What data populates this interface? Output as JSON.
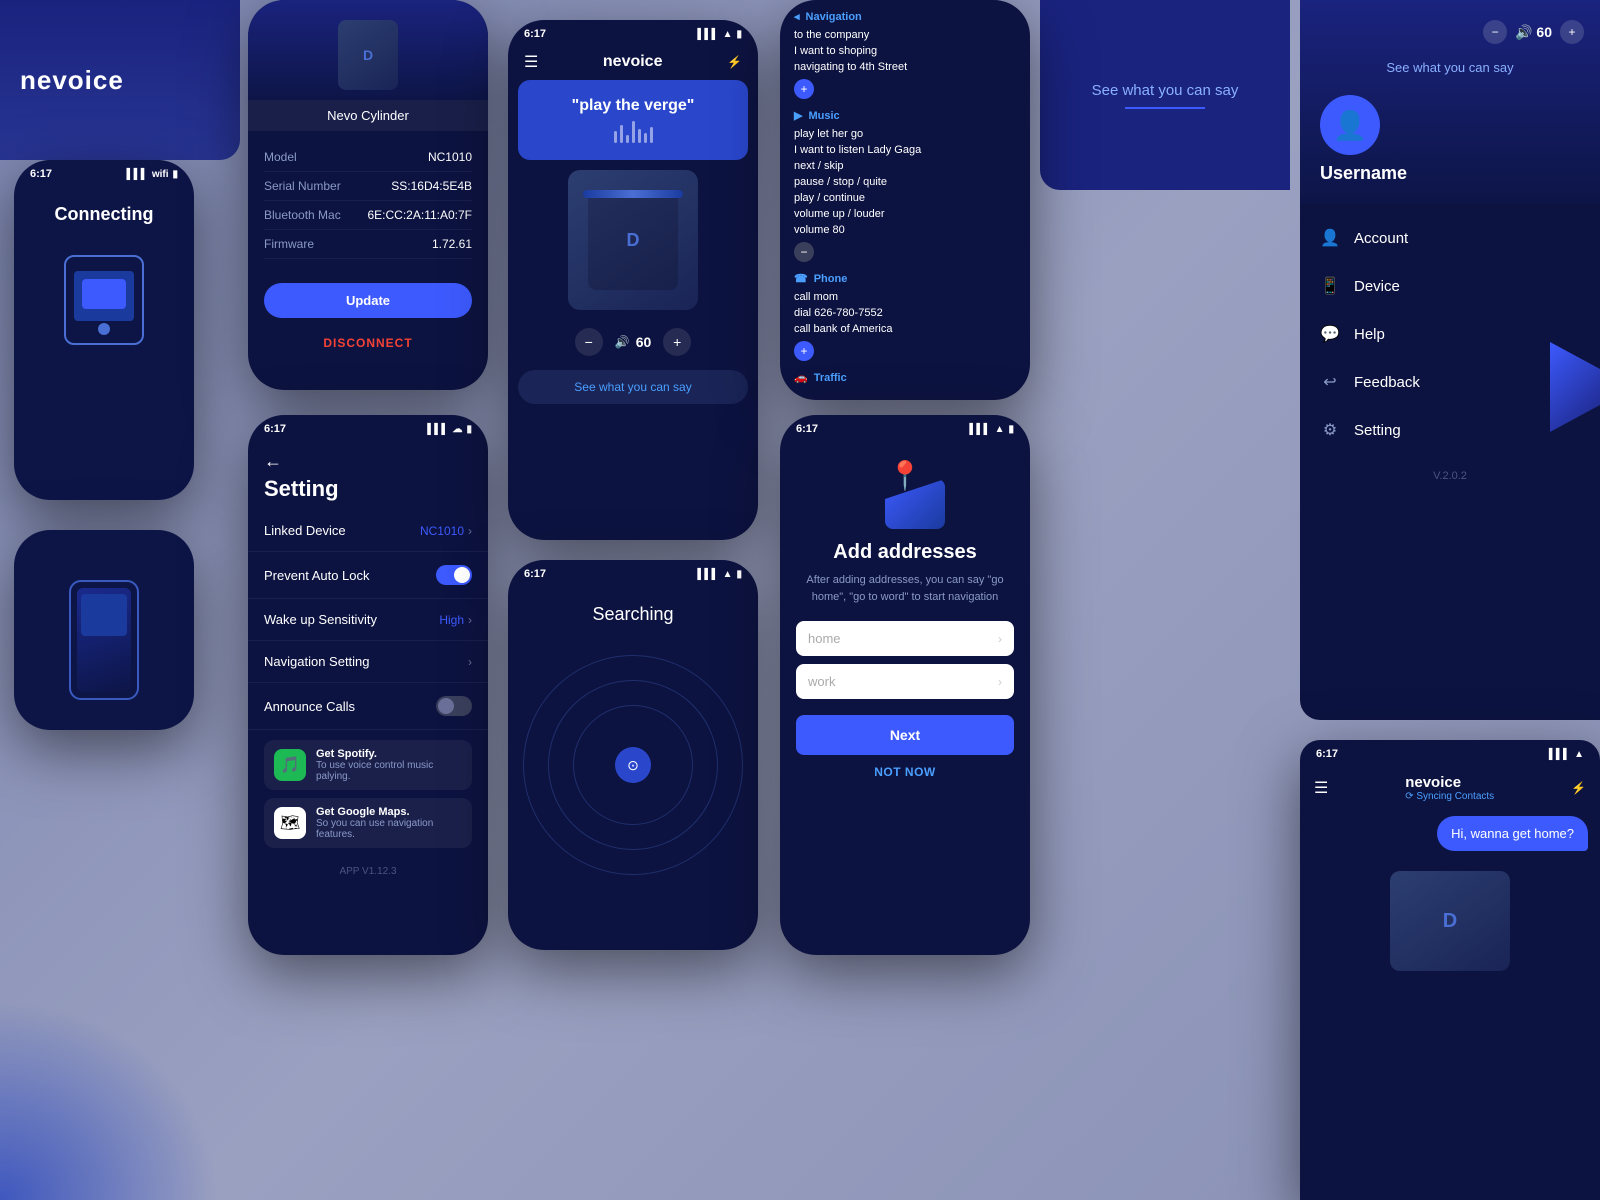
{
  "app": {
    "name": "nevoice"
  },
  "header": {
    "logo": "nevoice"
  },
  "phone_connecting": {
    "status_time": "6:17",
    "title": "Connecting"
  },
  "phone_device": {
    "device_name": "Nevo  Cylinder",
    "model_label": "Model",
    "model_value": "NC1010",
    "serial_label": "Serial Number",
    "serial_value": "SS:16D4:5E4B",
    "bluetooth_label": "Bluetooth Mac",
    "bluetooth_value": "6E:CC:2A:11:A0:7F",
    "firmware_label": "Firmware",
    "firmware_value": "1.72.61",
    "update_btn": "Update",
    "disconnect_btn": "DISCONNECT"
  },
  "phone_settings": {
    "status_time": "6:17",
    "back": "←",
    "title": "Setting",
    "linked_device_label": "Linked Device",
    "linked_device_value": "NC1010",
    "prevent_lock_label": "Prevent Auto Lock",
    "wakeup_label": "Wake up Sensitivity",
    "wakeup_value": "High",
    "nav_label": "Navigation Setting",
    "announce_label": "Announce Calls",
    "spotify_title": "Get Spotify.",
    "spotify_sub": "To use voice control music palying.",
    "maps_title": "Get Google Maps.",
    "maps_sub": "So you can use navigation features.",
    "app_version": "APP V1.12.3"
  },
  "phone_main": {
    "status_time": "6:17",
    "logo": "nevoice",
    "voice_command": "\"play the verge\"",
    "volume_minus": "−",
    "volume_value": "60",
    "volume_plus": "+",
    "see_what_say": "See what you can say"
  },
  "phone_searching": {
    "status_time": "6:17",
    "title": "Searching"
  },
  "phone_commands": {
    "nav_section": "Navigation",
    "nav_items": [
      "to the company",
      "I want to shoping",
      "navigating to 4th Street"
    ],
    "music_section": "Music",
    "music_items": [
      "play let her go",
      "I want to listen Lady Gaga",
      "next / skip",
      "pause / stop / quite",
      "play / continue",
      "volume up / louder",
      "volume 80"
    ],
    "phone_section": "Phone",
    "phone_items": [
      "call mom",
      "dial 626-780-7552",
      "call bank of America"
    ],
    "traffic_section": "Traffic"
  },
  "phone_addresses": {
    "status_time": "6:17",
    "title": "Add addresses",
    "subtitle": "After adding addresses, you can say \"go home\", \"go to word\" to start navigation",
    "home_placeholder": "home",
    "work_placeholder": "work",
    "next_btn": "Next",
    "not_now_btn": "NOT NOW"
  },
  "phone_profile": {
    "volume_minus": "−",
    "volume_value": "60",
    "volume_plus": "+",
    "username": "Username",
    "account_label": "Account",
    "device_label": "Device",
    "help_label": "Help",
    "feedback_label": "Feedback",
    "setting_label": "Setting",
    "version": "V.2.0.2"
  },
  "see_what_top_right": {
    "label": "See what you can say"
  },
  "phone_chat": {
    "status_time": "6:17",
    "logo": "nevoice",
    "sync_text": "Syncing Contacts",
    "bubble_text": "Hi,  wanna get home?"
  }
}
